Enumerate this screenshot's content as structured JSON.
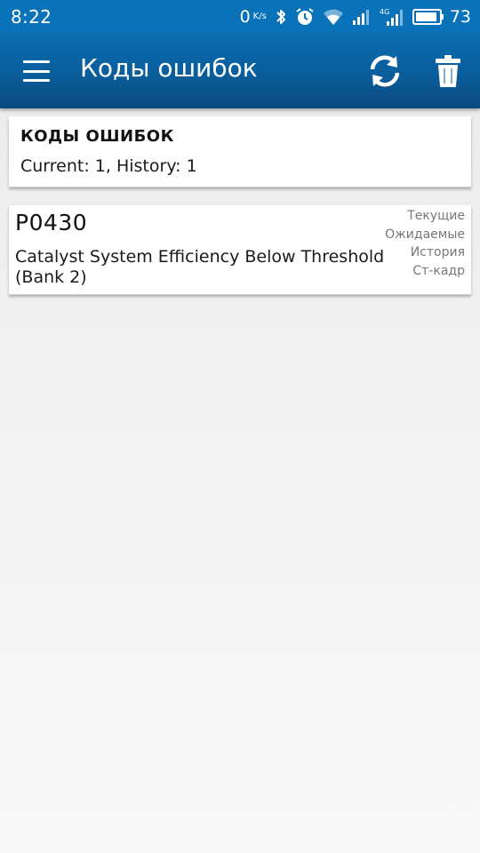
{
  "status_bar": {
    "time": "8:22",
    "net_speed": "0",
    "net_unit": "K/s",
    "network_type": "4G",
    "battery_level": "73",
    "icons": [
      "bluetooth-icon",
      "alarm-icon",
      "wifi-icon",
      "signal-icon",
      "signal-4g-icon",
      "battery-icon"
    ]
  },
  "app_bar": {
    "title": "Коды ошибок",
    "icons": [
      "menu-icon",
      "refresh-icon",
      "trash-icon"
    ],
    "color": "#0a5d9b"
  },
  "summary": {
    "title": "КОДЫ ОШИБОК",
    "text": "Current: 1, History: 1"
  },
  "dtc_list": [
    {
      "code": "P0430",
      "description": "Catalyst System Efficiency Below Threshold (Bank 2)",
      "flags": [
        "Текущие",
        "Ожидаемые",
        "История",
        "Ст-кадр"
      ]
    }
  ]
}
